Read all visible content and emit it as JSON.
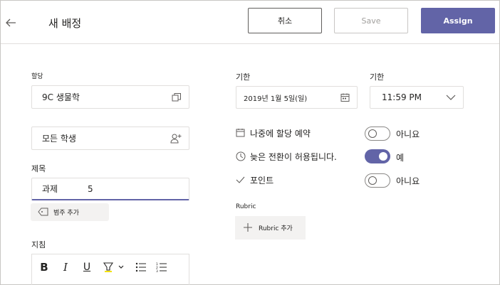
{
  "header": {
    "title": "새 배정",
    "cancel_label": "취소",
    "save_label": "Save",
    "assign_label": "Assign"
  },
  "left": {
    "assign_label": "할당",
    "class_value": "9C 생물학",
    "students_value": "모든 학생",
    "title_label": "제목",
    "title_value": "과제           5",
    "category_chip": "범주 추가",
    "instructions_label": "지침"
  },
  "right": {
    "due_label": "기한",
    "due_date": "2019년 1월 5일(일)",
    "time_label": "기한",
    "due_time": "11:59 PM",
    "options": [
      {
        "label": "나중에 할당 예약",
        "state": "아니요",
        "on": false,
        "icon": "calendar-icon"
      },
      {
        "label": "늦은 전환이 허용됩니다.",
        "state": "예",
        "on": true,
        "icon": "clock-icon"
      },
      {
        "label": "포인트",
        "state": "아니요",
        "on": false,
        "icon": "check-icon"
      }
    ],
    "rubric_label": "Rubric",
    "rubric_button": "Rubric 추가"
  },
  "toolbar": [
    "bold-icon",
    "italic-icon",
    "underline-icon",
    "highlight-icon",
    "bullet-list-icon",
    "numbered-list-icon"
  ],
  "colors": {
    "accent": "#6264a7",
    "border": "#e1dfdd",
    "muted": "#a19f9d"
  }
}
